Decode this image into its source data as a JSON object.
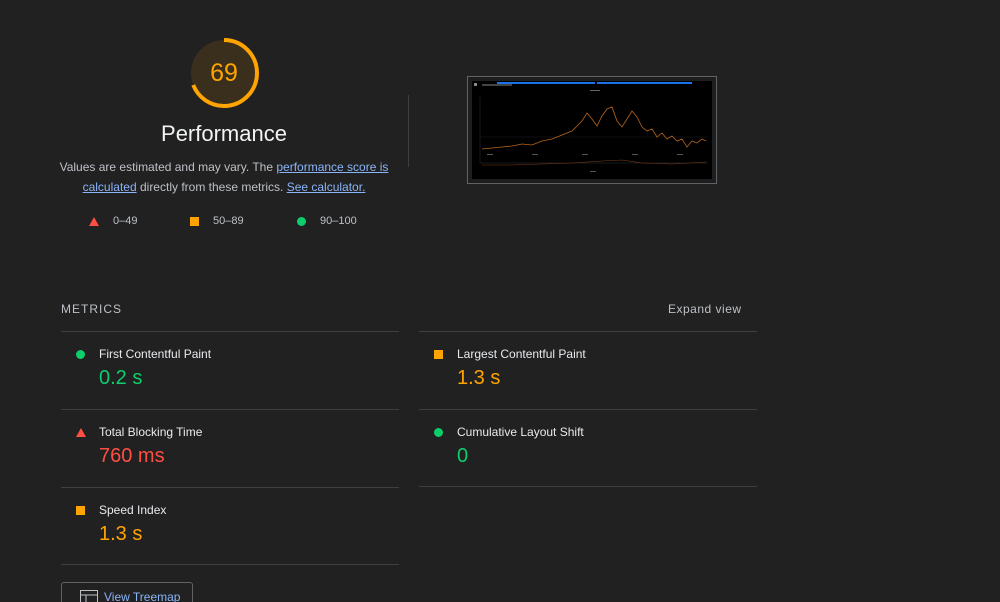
{
  "score": {
    "value": "69",
    "fraction": 0.69,
    "label": "Performance",
    "color": "#ffa400"
  },
  "description": {
    "pre": "Values are estimated and may vary. The ",
    "link1": "performance score is calculated",
    "mid": " directly from these metrics. ",
    "link2": "See calculator."
  },
  "legend": [
    {
      "shape": "triangle",
      "label": "0–49",
      "color": "#ff4e42"
    },
    {
      "shape": "square",
      "label": "50–89",
      "color": "#ffa400"
    },
    {
      "shape": "circle",
      "label": "90–100",
      "color": "#0cce6b"
    }
  ],
  "metrics": {
    "header": "METRICS",
    "expand": "Expand view",
    "items": [
      {
        "title": "First Contentful Paint",
        "value": "0.2 s",
        "rating": "pass"
      },
      {
        "title": "Largest Contentful Paint",
        "value": "1.3 s",
        "rating": "average"
      },
      {
        "title": "Total Blocking Time",
        "value": "760 ms",
        "rating": "fail"
      },
      {
        "title": "Cumulative Layout Shift",
        "value": "0",
        "rating": "pass"
      },
      {
        "title": "Speed Index",
        "value": "1.3 s",
        "rating": "average"
      }
    ]
  },
  "treemap": {
    "label": "View Treemap",
    "icon": "treemap-icon"
  }
}
